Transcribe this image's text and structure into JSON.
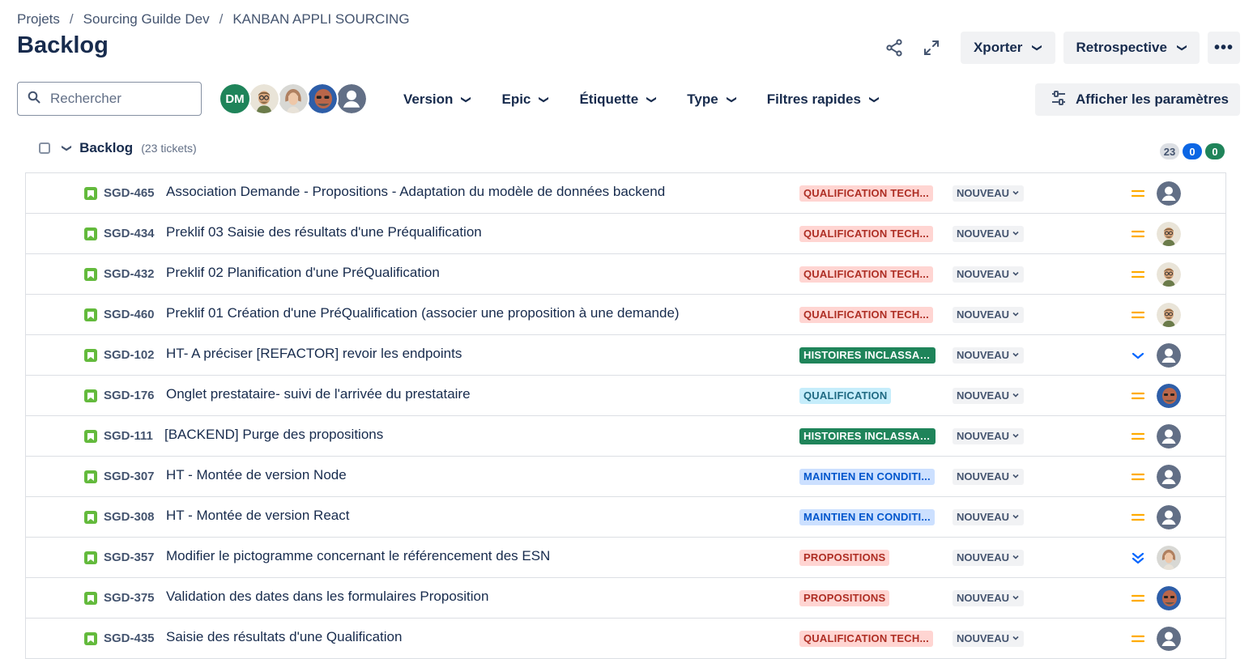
{
  "breadcrumb": [
    "Projets",
    "Sourcing Guilde Dev",
    "KANBAN APPLI SOURCING"
  ],
  "page_title": "Backlog",
  "actions": {
    "export_label": "Xporter",
    "retro_label": "Retrospective",
    "more_label": "•••"
  },
  "search": {
    "placeholder": "Rechercher"
  },
  "avatars": [
    {
      "initials": "DM",
      "color": "#1f845a",
      "kind": "initials"
    },
    {
      "kind": "photo-man-glasses"
    },
    {
      "kind": "photo-woman"
    },
    {
      "kind": "photo-man-bald"
    },
    {
      "kind": "default"
    }
  ],
  "filters": [
    {
      "label": "Version"
    },
    {
      "label": "Epic"
    },
    {
      "label": "Étiquette"
    },
    {
      "label": "Type"
    },
    {
      "label": "Filtres rapides"
    }
  ],
  "settings_label": "Afficher les paramètres",
  "section": {
    "title": "Backlog",
    "count": "(23 tickets)",
    "badges": [
      "23",
      "0",
      "0"
    ]
  },
  "colors": {
    "epic_red_bg": "#ffd5d2",
    "epic_red_fg": "#ae2e24",
    "epic_green_bg": "#1f845a",
    "epic_green_fg": "#ffffff",
    "epic_teal_bg": "#c6edfb",
    "epic_teal_fg": "#206a83",
    "epic_blue_bg": "#cce0ff",
    "epic_blue_fg": "#0055cc",
    "prio_medium": "#ffab00",
    "prio_low": "#0065ff"
  },
  "issues": [
    {
      "key": "SGD-465",
      "summary": "Association Demande - Propositions - Adaptation du modèle de données backend",
      "epic": "QUALIFICATION TECH...",
      "epic_style": "red",
      "status": "NOUVEAU",
      "priority": "medium-icon",
      "assignee": "default"
    },
    {
      "key": "SGD-434",
      "summary": "Preklif 03 Saisie des résultats d'une Préqualification",
      "epic": "QUALIFICATION TECH...",
      "epic_style": "red",
      "status": "NOUVEAU",
      "priority": "medium-icon",
      "assignee": "photo-man-glasses"
    },
    {
      "key": "SGD-432",
      "summary": "Preklif 02 Planification d'une PréQualification",
      "epic": "QUALIFICATION TECH...",
      "epic_style": "red",
      "status": "NOUVEAU",
      "priority": "medium-icon",
      "assignee": "photo-man-glasses"
    },
    {
      "key": "SGD-460",
      "summary": "Preklif 01 Création d'une PréQualification (associer une proposition à une demande)",
      "epic": "QUALIFICATION TECH...",
      "epic_style": "red",
      "status": "NOUVEAU",
      "priority": "medium-icon",
      "assignee": "photo-man-glasses"
    },
    {
      "key": "SGD-102",
      "summary": "HT- A préciser [REFACTOR] revoir les endpoints",
      "epic": "HISTOIRES INCLASSAB...",
      "epic_style": "green",
      "status": "NOUVEAU",
      "priority": "low-icon",
      "assignee": "default"
    },
    {
      "key": "SGD-176",
      "summary": "Onglet prestataire- suivi de l'arrivée du prestataire",
      "epic": "QUALIFICATION",
      "epic_style": "teal",
      "status": "NOUVEAU",
      "priority": "medium-icon",
      "assignee": "photo-man-bald"
    },
    {
      "key": "SGD-111",
      "summary": "[BACKEND] Purge des propositions",
      "epic": "HISTOIRES INCLASSAB...",
      "epic_style": "green",
      "status": "NOUVEAU",
      "priority": "medium-icon",
      "assignee": "default"
    },
    {
      "key": "SGD-307",
      "summary": "HT - Montée de version Node",
      "epic": "MAINTIEN EN CONDITI...",
      "epic_style": "blue",
      "status": "NOUVEAU",
      "priority": "medium-icon",
      "assignee": "default"
    },
    {
      "key": "SGD-308",
      "summary": "HT - Montée de version React",
      "epic": "MAINTIEN EN CONDITI...",
      "epic_style": "blue",
      "status": "NOUVEAU",
      "priority": "medium-icon",
      "assignee": "default"
    },
    {
      "key": "SGD-357",
      "summary": "Modifier le pictogramme concernant le référencement des ESN",
      "epic": "PROPOSITIONS",
      "epic_style": "red",
      "status": "NOUVEAU",
      "priority": "lowest-icon",
      "assignee": "photo-woman"
    },
    {
      "key": "SGD-375",
      "summary": "Validation des dates dans les formulaires Proposition",
      "epic": "PROPOSITIONS",
      "epic_style": "red",
      "status": "NOUVEAU",
      "priority": "medium-icon",
      "assignee": "photo-man-bald"
    },
    {
      "key": "SGD-435",
      "summary": "Saisie des résultats d'une Qualification",
      "epic": "QUALIFICATION TECH...",
      "epic_style": "red",
      "status": "NOUVEAU",
      "priority": "medium-icon",
      "assignee": "default"
    }
  ]
}
